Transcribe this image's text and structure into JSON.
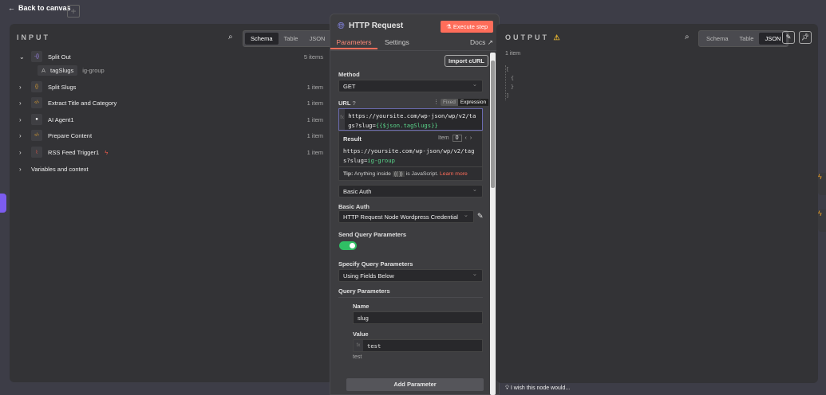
{
  "topbar": {
    "back_label": "Back to canvas",
    "add_label": "+"
  },
  "input": {
    "title": "INPUT",
    "views": [
      "Schema",
      "Table",
      "JSON"
    ],
    "active_view": "Schema",
    "nodes": [
      {
        "name": "Split Out",
        "count": "5 items",
        "expanded": true,
        "icon": "split-out-icon"
      },
      {
        "name": "Split Slugs",
        "count": "1 item",
        "icon": "braces-icon"
      },
      {
        "name": "Extract Title and Category",
        "count": "1 item",
        "icon": "code-icon"
      },
      {
        "name": "AI Agent1",
        "count": "1 item",
        "icon": "robot-icon"
      },
      {
        "name": "Prepare Content",
        "count": "1 item",
        "icon": "code-icon"
      },
      {
        "name": "RSS Feed Trigger1",
        "count": "1 item",
        "icon": "rss-icon"
      }
    ],
    "field": {
      "type": "A",
      "key": "tagSlugs",
      "value": "ig-group"
    },
    "variables_label": "Variables and context"
  },
  "node": {
    "title": "HTTP Request",
    "execute_label": "Execute step",
    "tabs": [
      "Parameters",
      "Settings"
    ],
    "docs_label": "Docs",
    "import_curl": "Import cURL",
    "method_label": "Method",
    "method_value": "GET",
    "url_label": "URL",
    "url_modes": [
      "Fixed",
      "Expression"
    ],
    "url_plain": "https://yoursite.com/wp-json/wp/v2/tags?slug=",
    "url_expr": "{{$json.tagSlugs}}",
    "result_label": "Result",
    "item_label": "Item",
    "item_index": "0",
    "result_plain": "https://yoursite.com/wp-json/wp/v2/tags?slug=",
    "result_value": "ig-group",
    "tip_label": "Tip:",
    "tip_text": "Anything inside",
    "tip_code": "{{ }}",
    "tip_text2": "is JavaScript.",
    "tip_link": "Learn more",
    "auth_value": "Basic Auth",
    "basic_auth_label": "Basic Auth",
    "credential_value": "HTTP Request Node Wordpress Credential",
    "send_query_label": "Send Query Parameters",
    "send_query_on": true,
    "specify_label": "Specify Query Parameters",
    "specify_value": "Using Fields Below",
    "query_params_label": "Query Parameters",
    "name_label": "Name",
    "name_value": "slug",
    "value_label": "Value",
    "value_value": "test",
    "value_preview": "test",
    "add_param_label": "Add Parameter"
  },
  "output": {
    "title": "OUTPUT",
    "views": [
      "Schema",
      "Table",
      "JSON"
    ],
    "active_view": "JSON",
    "count": "1 item",
    "json_lines": [
      "[",
      "{",
      "}",
      "]"
    ],
    "feedback": "I wish this node would..."
  },
  "colors": {
    "accent": "#ff6d5a",
    "green": "#2fbf64"
  }
}
